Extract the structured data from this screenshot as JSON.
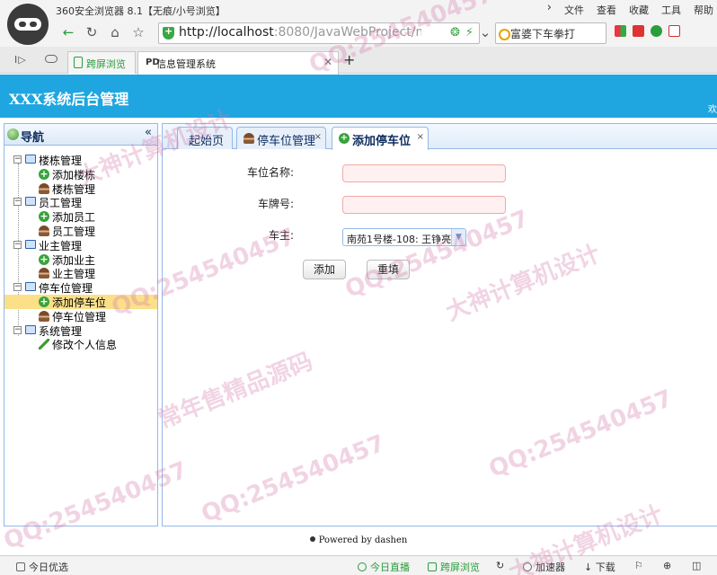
{
  "browser": {
    "window_title": "360安全浏览器 8.1【无痕/小号浏览】",
    "menu": [
      "文件",
      "查看",
      "收藏",
      "工具",
      "帮助"
    ],
    "url_host": "http://localhost",
    "url_rest": ":8080/JavaWebProject/main_",
    "search_placeholder": "富婆下车拳打",
    "tabs": [
      {
        "label": "跨屏浏览"
      },
      {
        "label": "信息管理系统"
      }
    ],
    "new_tab_symbol": "+"
  },
  "header": {
    "title": "XXX系统后台管理",
    "right_text": "欢"
  },
  "sidebar": {
    "title": "导航",
    "collapse_symbol": "«",
    "tree": [
      {
        "label": "楼栋管理",
        "children": [
          {
            "label": "添加楼栋",
            "icon": "add-icon"
          },
          {
            "label": "楼栋管理",
            "icon": "user-icon"
          }
        ]
      },
      {
        "label": "员工管理",
        "children": [
          {
            "label": "添加员工",
            "icon": "add-icon"
          },
          {
            "label": "员工管理",
            "icon": "user-icon"
          }
        ]
      },
      {
        "label": "业主管理",
        "children": [
          {
            "label": "添加业主",
            "icon": "add-icon"
          },
          {
            "label": "业主管理",
            "icon": "user-icon"
          }
        ]
      },
      {
        "label": "停车位管理",
        "children": [
          {
            "label": "添加停车位",
            "icon": "add-icon",
            "selected": true
          },
          {
            "label": "停车位管理",
            "icon": "user-icon"
          }
        ]
      },
      {
        "label": "系统管理",
        "children": [
          {
            "label": "修改个人信息",
            "icon": "pen-icon"
          }
        ]
      }
    ]
  },
  "main": {
    "tabs": [
      {
        "label": "起始页",
        "closable": false
      },
      {
        "label": "停车位管理",
        "closable": true
      },
      {
        "label": "添加停车位",
        "closable": true,
        "active": true
      }
    ],
    "form": {
      "space_name_label": "车位名称:",
      "space_name_value": "",
      "plate_label": "车牌号:",
      "plate_value": "",
      "owner_label": "车主:",
      "owner_value": "南苑1号楼-108: 王铮亮",
      "add_button": "添加",
      "reset_button": "重填"
    }
  },
  "footer": {
    "text": "Powered by dashen"
  },
  "statusbar": {
    "left": "今日优选",
    "items": [
      "今日直播",
      "跨屏浏览",
      "加速器",
      "下载"
    ]
  },
  "watermarks": [
    "QQ:254540457",
    "大神计算机设计",
    "常年售精品源码"
  ],
  "colors": {
    "header": "#1fa6e0",
    "border": "#95b8e7",
    "selected": "#fbe089",
    "invalid_input_bg": "#fff1f1"
  }
}
